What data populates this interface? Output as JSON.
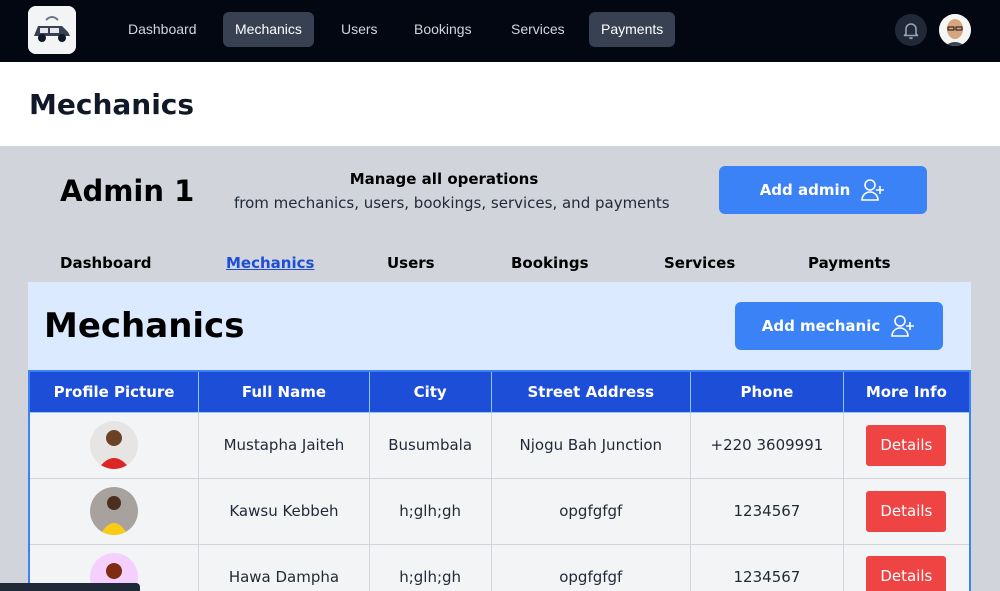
{
  "nav": {
    "items": [
      {
        "label": "Dashboard",
        "active": false
      },
      {
        "label": "Mechanics",
        "active": true
      },
      {
        "label": "Users",
        "active": false
      },
      {
        "label": "Bookings",
        "active": false
      },
      {
        "label": "Services",
        "active": false
      },
      {
        "label": "Payments",
        "active": true
      }
    ],
    "icons": {
      "logo": "car-logo-icon",
      "notifications": "bell-icon",
      "profile": "user-avatar"
    }
  },
  "header": {
    "title": "Mechanics"
  },
  "admin": {
    "name": "Admin 1",
    "manage_title": "Manage all operations",
    "manage_subtitle": "from mechanics, users, bookings, services, and payments",
    "add_admin_label": "Add admin"
  },
  "subtabs": [
    {
      "label": "Dashboard",
      "active": false
    },
    {
      "label": "Mechanics",
      "active": true
    },
    {
      "label": "Users",
      "active": false
    },
    {
      "label": "Bookings",
      "active": false
    },
    {
      "label": "Services",
      "active": false
    },
    {
      "label": "Payments",
      "active": false
    }
  ],
  "mechanics": {
    "title": "Mechanics",
    "add_label": "Add mechanic",
    "columns": [
      "Profile Picture",
      "Full Name",
      "City",
      "Street Address",
      "Phone",
      "More Info"
    ],
    "rows": [
      {
        "name": "Mustapha Jaiteh",
        "city": "Busumbala",
        "address": "Njogu Bah Junction",
        "phone": "+220 3609991",
        "action": "Details"
      },
      {
        "name": "Kawsu Kebbeh",
        "city": "h;glh;gh",
        "address": "opgfgfgf",
        "phone": "1234567",
        "action": "Details"
      },
      {
        "name": "Hawa Dampha",
        "city": "h;glh;gh",
        "address": "opgfgfgf",
        "phone": "1234567",
        "action": "Details"
      }
    ]
  },
  "colors": {
    "nav_bg": "#030712",
    "primary": "#3b82f6",
    "table_header": "#1d4ed8",
    "danger": "#ef4444",
    "panel_bg": "#dbeafe"
  }
}
